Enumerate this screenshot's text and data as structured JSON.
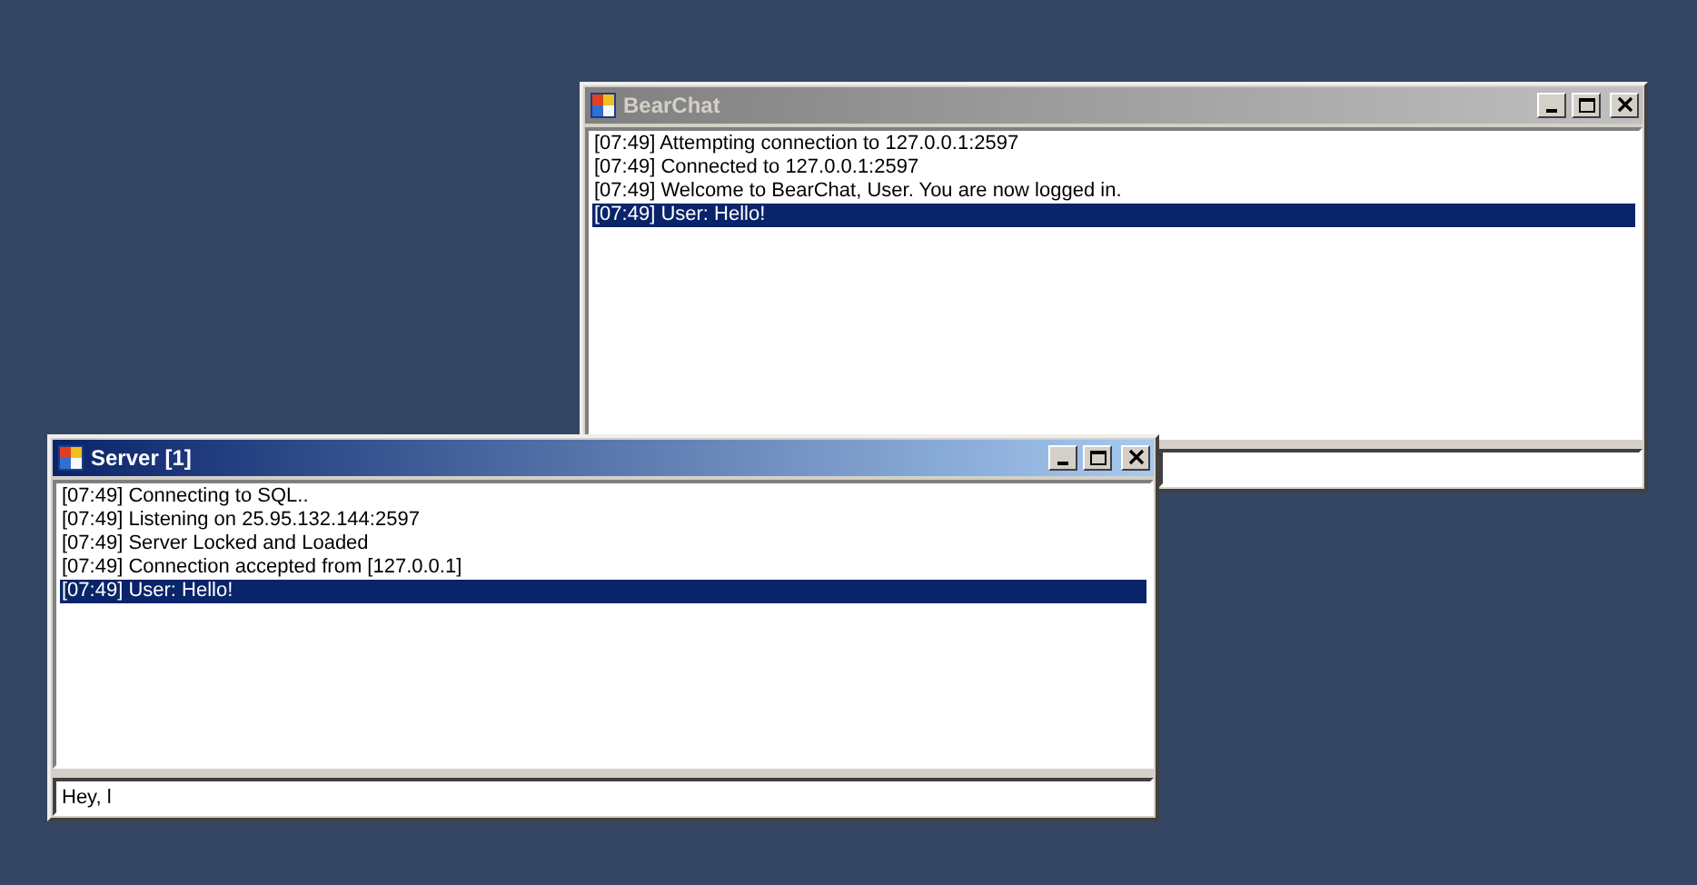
{
  "windows": [
    {
      "title": "BearChat",
      "active": false,
      "messages": [
        {
          "text": "[07:49] Attempting connection to 127.0.0.1:2597",
          "selected": false
        },
        {
          "text": "[07:49] Connected to 127.0.0.1:2597",
          "selected": false
        },
        {
          "text": "[07:49] Welcome to BearChat, User. You are now logged in.",
          "selected": false
        },
        {
          "text": "[07:49] User: Hello!",
          "selected": true
        }
      ]
    },
    {
      "title": "Server [1]",
      "active": true,
      "messages": [
        {
          "text": "[07:49] Connecting to SQL..",
          "selected": false
        },
        {
          "text": "[07:49] Listening on 25.95.132.144:2597",
          "selected": false
        },
        {
          "text": "[07:49] Server Locked and Loaded",
          "selected": false
        },
        {
          "text": "[07:49] Connection accepted from [127.0.0.1]",
          "selected": false
        },
        {
          "text": "[07:49] User: Hello!",
          "selected": true
        }
      ],
      "input": {
        "value": "Hey, l"
      }
    }
  ]
}
